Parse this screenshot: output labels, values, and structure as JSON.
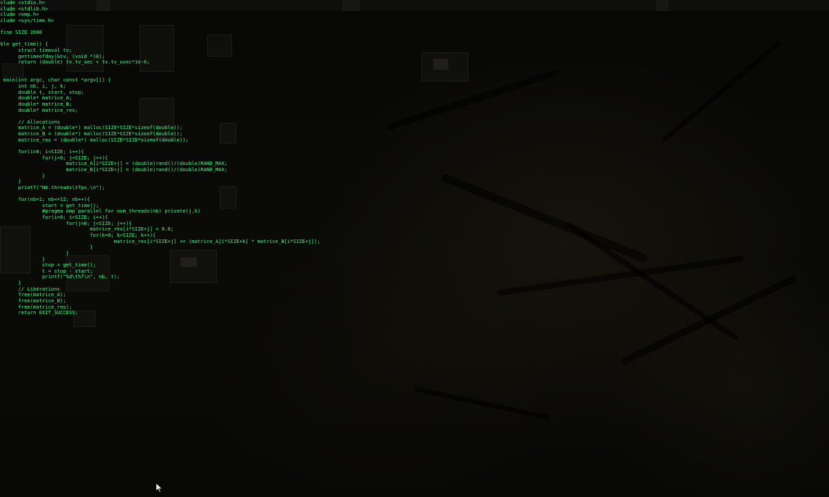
{
  "terminal": {
    "lines": [
      "nclude <stdio.h>",
      "nclude <stdlib.h>",
      "nclude <omp.h>",
      "nclude <sys/time.h>",
      "",
      "efine SIZE 2000",
      "",
      "uble get_time() {",
      "       struct timeval tv;",
      "       gettimeofday(&tv, (void *)0);",
      "       return (double) tv.tv_sec + tv.tv_usec*1e-6;",
      "",
      "",
      "t main(int argc, char const *argv[]) {",
      "       int nb, i, j, k;",
      "       double t, start, stop;",
      "       double* matrice_A;",
      "       double* matrice_B;",
      "       double* matrice_res;",
      "",
      "       // Allocations",
      "       matrice_A = (double*) malloc(SIZE*SIZE*sizeof(double));",
      "       matrice_B = (double*) malloc(SIZE*SIZE*sizeof(double));",
      "       matrice_res = (double*) malloc(SIZE*SIZE*sizeof(double));",
      "",
      "       for(i=0; i<SIZE; i++){",
      "               for(j=0; j<SIZE; j++){",
      "                       matrice_A[i*SIZE+j] = (double)rand()/(double)RAND_MAX;",
      "                       matrice_B[i*SIZE+j] = (double)rand()/(double)RAND_MAX;",
      "               }",
      "       }",
      "       printf(\"Nb.threads\\tTps.\\n\");",
      "",
      "       for(nb=1; nb<=12; nb++){",
      "               start = get_time();",
      "               #pragma omp parallel for num_threads(nb) private(j,k)",
      "               for(i=0; i<SIZE; i++){",
      "                       for(j=0; j<SIZE; j++){",
      "                               matrice_res[i*SIZE+j] = 0.0;",
      "                               for(k=0; k<SIZE; k++){",
      "                                       matrice_res[i*SIZE+j] += (matrice_A[i*SIZE+k] * matrice_B[i*SIZE+j]);",
      "                               }",
      "                       }",
      "               }",
      "               stop = get_time();",
      "               t = stop - start;",
      "               printf(\"%d\\t%f\\n\", nb, t);",
      "       }",
      "       // Libérations",
      "       free(matrice_A);",
      "       free(matrice_B);",
      "       free(matrice_res);",
      "       return EXIT_SUCCESS;"
    ]
  },
  "colors": {
    "terminal_text": "#3fe27a",
    "background": "#050504"
  },
  "icons": {
    "pointer": "mouse-pointer-icon"
  }
}
